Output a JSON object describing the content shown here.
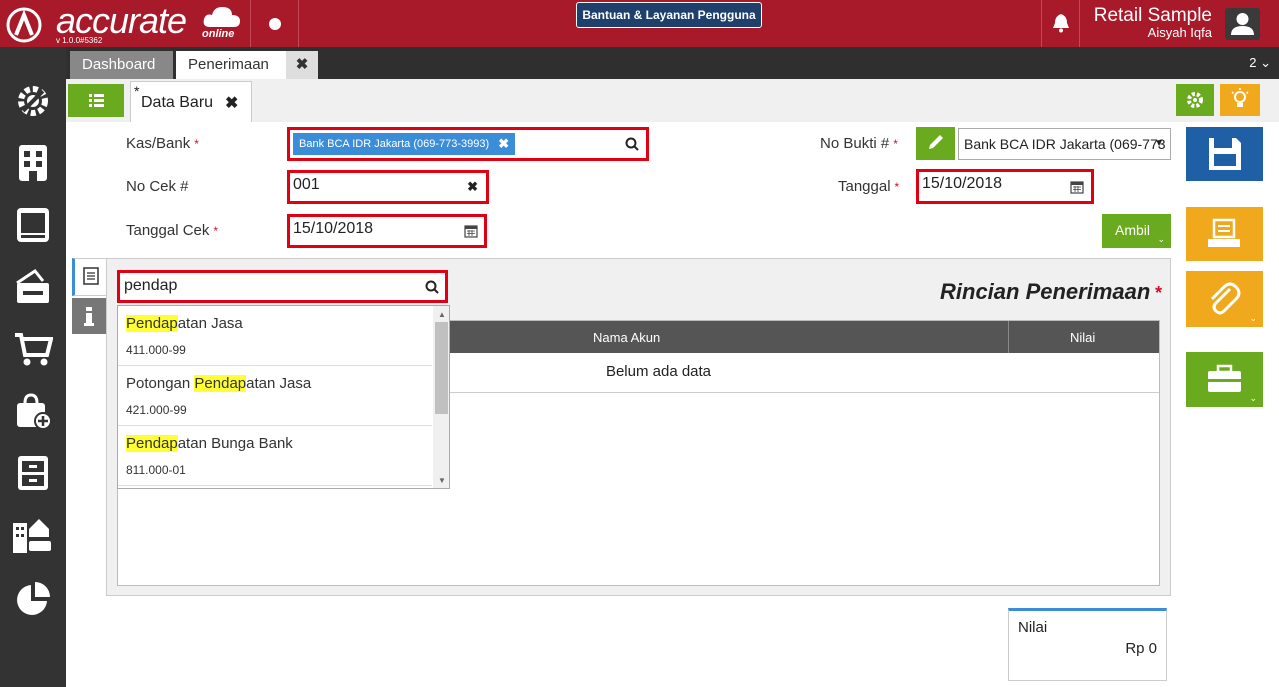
{
  "app": {
    "logo_text": "accurate",
    "logo_sub": "online",
    "version": "v 1.0.0#5362",
    "help_button": "Bantuan & Layanan Pengguna",
    "company": "Retail Sample",
    "user": "Aisyah Iqfa"
  },
  "tabs": {
    "dashboard": "Dashboard",
    "penerimaan": "Penerimaan",
    "close": "✖",
    "count": "2 ⌄"
  },
  "subtab": {
    "label": "Data Baru",
    "modified_mark": "*",
    "close": "✖"
  },
  "form": {
    "kas_bank_label": "Kas/Bank",
    "kas_bank_value": "Bank BCA IDR Jakarta (069-773-3993)",
    "no_cek_label": "No Cek #",
    "no_cek_value": "001",
    "tanggal_cek_label": "Tanggal Cek",
    "tanggal_cek_value": "15/10/2018",
    "no_bukti_label": "No Bukti #",
    "no_bukti_value": "Bank BCA IDR Jakarta (069-773",
    "tanggal_label": "Tanggal",
    "tanggal_value": "15/10/2018",
    "required_mark": "*",
    "ambil_button": "Ambil"
  },
  "detail": {
    "title": "Rincian Penerimaan",
    "required_mark": "*",
    "columns": [
      "Nama Akun",
      "Nilai"
    ],
    "empty_text": "Belum ada data"
  },
  "search": {
    "value": "pendap",
    "results": [
      {
        "pre": "",
        "match": "Pendap",
        "post": "atan Jasa",
        "code": "411.000-99"
      },
      {
        "pre": "Potongan ",
        "match": "Pendap",
        "post": "atan Jasa",
        "code": "421.000-99"
      },
      {
        "pre": "",
        "match": "Pendap",
        "post": "atan Bunga Bank",
        "code": "811.000-01"
      }
    ]
  },
  "total": {
    "label": "Nilai",
    "value": "Rp 0"
  },
  "colors": {
    "brand_red": "#a8192a",
    "green": "#6aaa1e",
    "orange": "#f0a81c",
    "blue": "#1e5fa6",
    "highlight": "#ffff33"
  }
}
